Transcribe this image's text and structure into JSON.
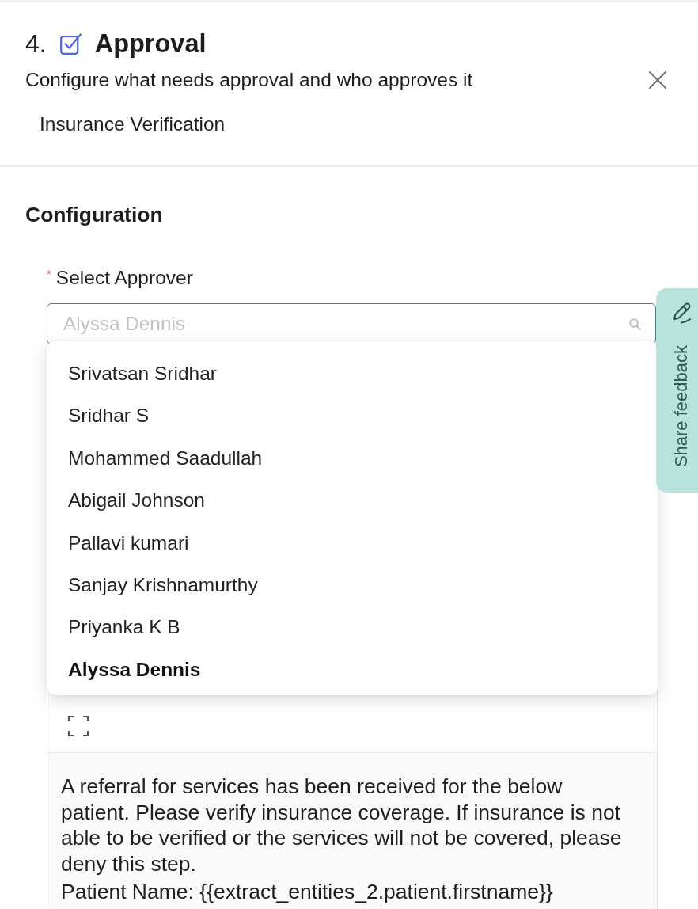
{
  "header": {
    "step_number": "4.",
    "title": "Approval",
    "subtitle": "Configure what needs approval and who approves it",
    "step_name": "Insurance Verification"
  },
  "configuration": {
    "heading": "Configuration",
    "approver_field": {
      "required_mark": "*",
      "label": "Select Approver",
      "placeholder": "Alyssa Dennis",
      "focused": true
    },
    "approver_dropdown": {
      "options": [
        {
          "label": "Srivatsan Sridhar",
          "selected": false
        },
        {
          "label": "Sridhar S",
          "selected": false
        },
        {
          "label": "Mohammed Saadullah",
          "selected": false
        },
        {
          "label": "Abigail Johnson",
          "selected": false
        },
        {
          "label": "Pallavi kumari",
          "selected": false
        },
        {
          "label": "Sanjay Krishnamurthy",
          "selected": false
        },
        {
          "label": "Priyanka K B",
          "selected": false
        },
        {
          "label": "Alyssa Dennis",
          "selected": true
        }
      ]
    },
    "message_editor": {
      "paragraphs": [
        "A referral for services has been received for the below patient. Please verify insurance coverage. If insurance is not able to be verified or the services will not be covered, please deny this step.",
        "Patient Name: {{extract_entities_2.patient.firstname}}"
      ]
    }
  },
  "feedback_tab": {
    "label": "Share feedback"
  }
}
